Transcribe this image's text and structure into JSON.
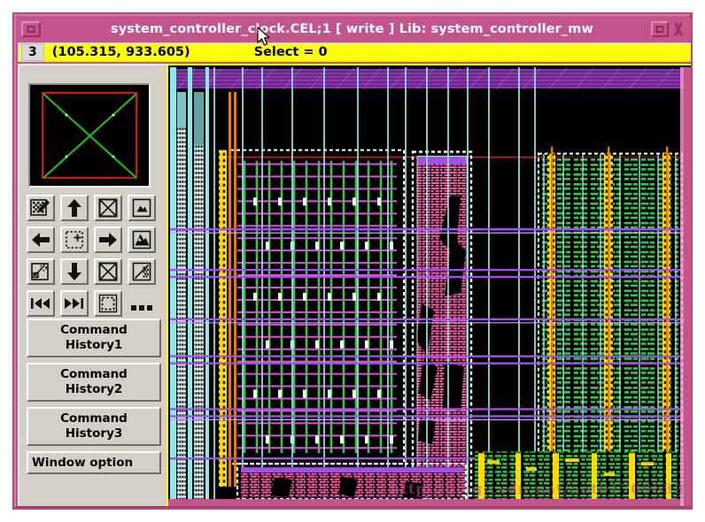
{
  "window": {
    "title": "system_controller_clock.CEL;1    [ write ]  Lib: system_controller_mw",
    "menu_button_icon": "window-menu-icon",
    "maximize_icon": "maximize-icon",
    "close_icon": "close-icon",
    "frame_color": "#c4548c"
  },
  "status": {
    "count": "3",
    "coords": "(105.315, 933.605)",
    "select": "Select = 0",
    "background": "#ffff00"
  },
  "thumbnail": {
    "name": "layout-overview-thumbnail",
    "border_color": "#e21010",
    "cross_color": "#14c814",
    "background": "#000000"
  },
  "toolbar": {
    "rows": [
      [
        {
          "name": "select-edit-icon",
          "label": "Select / Edit"
        },
        {
          "name": "pan-up-icon",
          "label": "Pan Up"
        },
        {
          "name": "zoom-fit-icon",
          "label": "Zoom Fit"
        },
        {
          "name": "zoom-in-icon",
          "label": "Zoom In"
        }
      ],
      [
        {
          "name": "pan-left-icon",
          "label": "Pan Left"
        },
        {
          "name": "zoom-area-icon",
          "label": "Zoom Area"
        },
        {
          "name": "pan-right-icon",
          "label": "Pan Right"
        },
        {
          "name": "zoom-out-icon",
          "label": "Zoom Out"
        }
      ],
      [
        {
          "name": "rotate-object-icon",
          "label": "Rotate"
        },
        {
          "name": "pan-down-icon",
          "label": "Pan Down"
        },
        {
          "name": "zoom-previous-icon",
          "label": "Zoom Previous"
        },
        {
          "name": "fill-pattern-icon",
          "label": "Fill Pattern"
        }
      ],
      [
        {
          "name": "rewind-icon",
          "label": "Previous View"
        },
        {
          "name": "fast-forward-icon",
          "label": "Next View"
        },
        {
          "name": "marquee-select-icon",
          "label": "Marquee Select"
        },
        {
          "name": "more-options-icon",
          "label": "More"
        }
      ]
    ]
  },
  "buttons": {
    "command_history_1": "Command\nHistory1",
    "command_history_1_line1": "Command",
    "command_history_1_line2": "History1",
    "command_history_2_line1": "Command",
    "command_history_2_line2": "History2",
    "command_history_3_line1": "Command",
    "command_history_3_line2": "History3",
    "window_option": "Window option"
  },
  "watermark": {
    "text": "http://blog.csdn.net/not01700639"
  },
  "canvas": {
    "name": "ic-layout-canvas",
    "background": "#000000",
    "colors": {
      "metal_horizontal": "#a64df0",
      "metal_horizontal_bright": "#e24de2",
      "metal_vertical": "#8fe8e8",
      "power_rail": "#ffdd00",
      "cell_green": "#2ecc40",
      "cell_pink": "#ff5fa8",
      "boundary_red": "#e21010",
      "boundary_white": "#ffffff",
      "chip_edge_pink": "#c4548c",
      "orange_rail": "#d98010"
    }
  }
}
